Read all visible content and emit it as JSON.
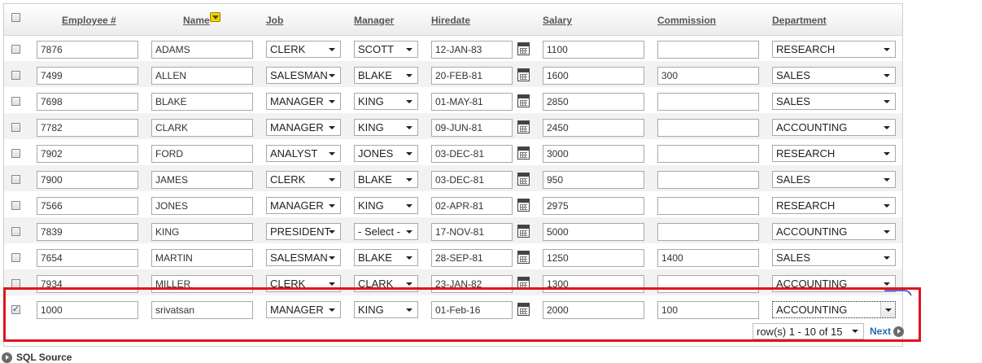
{
  "header": {
    "columns": [
      "Employee #",
      "Name",
      "Job",
      "Manager",
      "Hiredate",
      "Salary",
      "Commission",
      "Department"
    ]
  },
  "rows": [
    {
      "checked": false,
      "empno": "7876",
      "name": "ADAMS",
      "job": "CLERK",
      "mgr": "SCOTT",
      "hiredate": "12-JAN-83",
      "sal": "1100",
      "comm": "",
      "dept": "RESEARCH"
    },
    {
      "checked": false,
      "empno": "7499",
      "name": "ALLEN",
      "job": "SALESMAN",
      "mgr": "BLAKE",
      "hiredate": "20-FEB-81",
      "sal": "1600",
      "comm": "300",
      "dept": "SALES"
    },
    {
      "checked": false,
      "empno": "7698",
      "name": "BLAKE",
      "job": "MANAGER",
      "mgr": "KING",
      "hiredate": "01-MAY-81",
      "sal": "2850",
      "comm": "",
      "dept": "SALES"
    },
    {
      "checked": false,
      "empno": "7782",
      "name": "CLARK",
      "job": "MANAGER",
      "mgr": "KING",
      "hiredate": "09-JUN-81",
      "sal": "2450",
      "comm": "",
      "dept": "ACCOUNTING"
    },
    {
      "checked": false,
      "empno": "7902",
      "name": "FORD",
      "job": "ANALYST",
      "mgr": "JONES",
      "hiredate": "03-DEC-81",
      "sal": "3000",
      "comm": "",
      "dept": "RESEARCH"
    },
    {
      "checked": false,
      "empno": "7900",
      "name": "JAMES",
      "job": "CLERK",
      "mgr": "BLAKE",
      "hiredate": "03-DEC-81",
      "sal": "950",
      "comm": "",
      "dept": "SALES"
    },
    {
      "checked": false,
      "empno": "7566",
      "name": "JONES",
      "job": "MANAGER",
      "mgr": "KING",
      "hiredate": "02-APR-81",
      "sal": "2975",
      "comm": "",
      "dept": "RESEARCH"
    },
    {
      "checked": false,
      "empno": "7839",
      "name": "KING",
      "job": "PRESIDENT",
      "mgr": "- Select -",
      "hiredate": "17-NOV-81",
      "sal": "5000",
      "comm": "",
      "dept": "ACCOUNTING"
    },
    {
      "checked": false,
      "empno": "7654",
      "name": "MARTIN",
      "job": "SALESMAN",
      "mgr": "BLAKE",
      "hiredate": "28-SEP-81",
      "sal": "1250",
      "comm": "1400",
      "dept": "SALES"
    },
    {
      "checked": false,
      "empno": "7934",
      "name": "MILLER",
      "job": "CLERK",
      "mgr": "CLARK",
      "hiredate": "23-JAN-82",
      "sal": "1300",
      "comm": "",
      "dept": "ACCOUNTING"
    },
    {
      "checked": true,
      "empno": "1000",
      "name": "srivatsan",
      "job": "MANAGER",
      "mgr": "KING",
      "hiredate": "01-Feb-16",
      "sal": "2000",
      "comm": "100",
      "dept": "ACCOUNTING"
    }
  ],
  "pagination": {
    "range": "row(s) 1 - 10 of 15",
    "next": "Next"
  },
  "footer": {
    "sql_source": "SQL Source"
  },
  "colors": {
    "highlight": "#e0141e",
    "link": "#2a6ab0"
  }
}
